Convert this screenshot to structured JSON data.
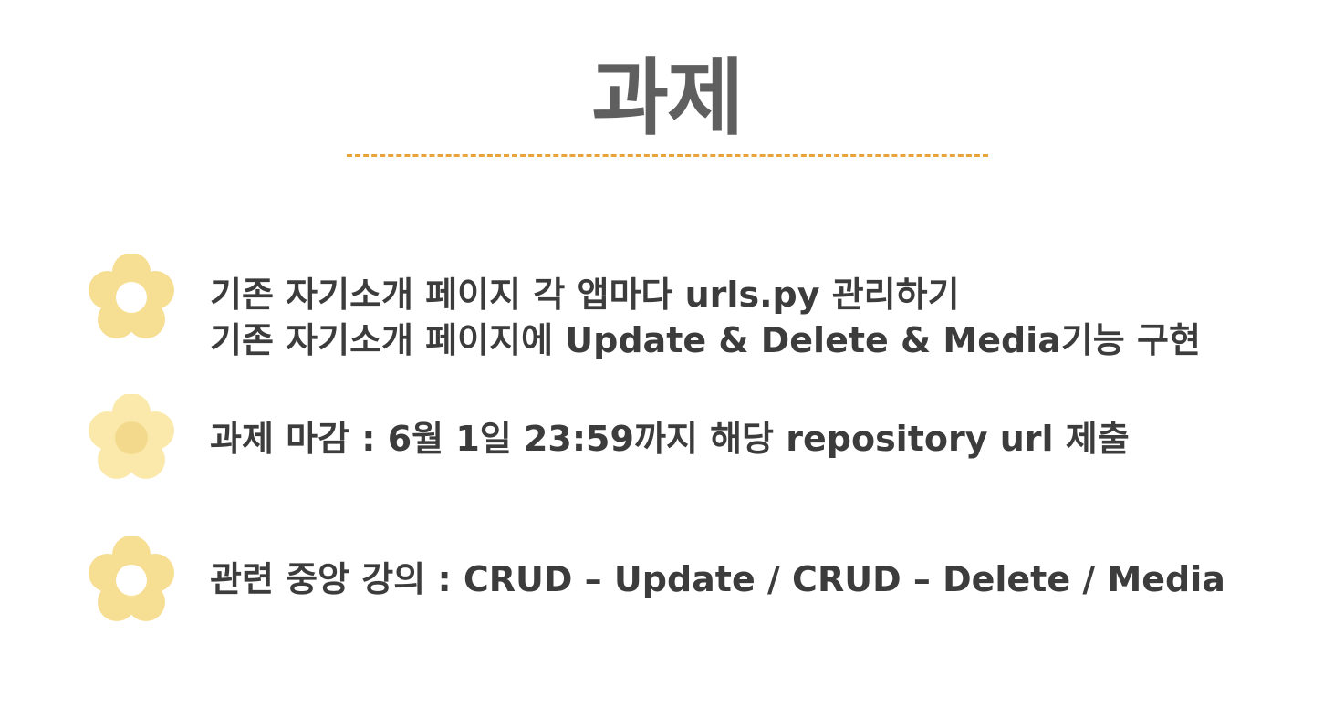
{
  "slide": {
    "title": "과제",
    "colors": {
      "title": "#5f5f5f",
      "divider": "#e8a33d",
      "text": "#3c3c3c",
      "flower": "#f6de93",
      "flower_light": "#fbe9ac",
      "flower_center": "#f3d98c"
    },
    "bullets": [
      {
        "icon": "flower-icon",
        "lines": [
          "기존 자기소개 페이지 각 앱마다 urls.py 관리하기",
          "기존 자기소개 페이지에 Update & Delete & Media기능 구현"
        ]
      },
      {
        "icon": "flower-icon",
        "lines": [
          "과제 마감 : 6월 1일 23:59까지 해당 repository url 제출"
        ]
      },
      {
        "icon": "flower-icon",
        "lines": [
          "관련 중앙 강의 : CRUD – Update / CRUD – Delete / Media"
        ]
      }
    ]
  }
}
